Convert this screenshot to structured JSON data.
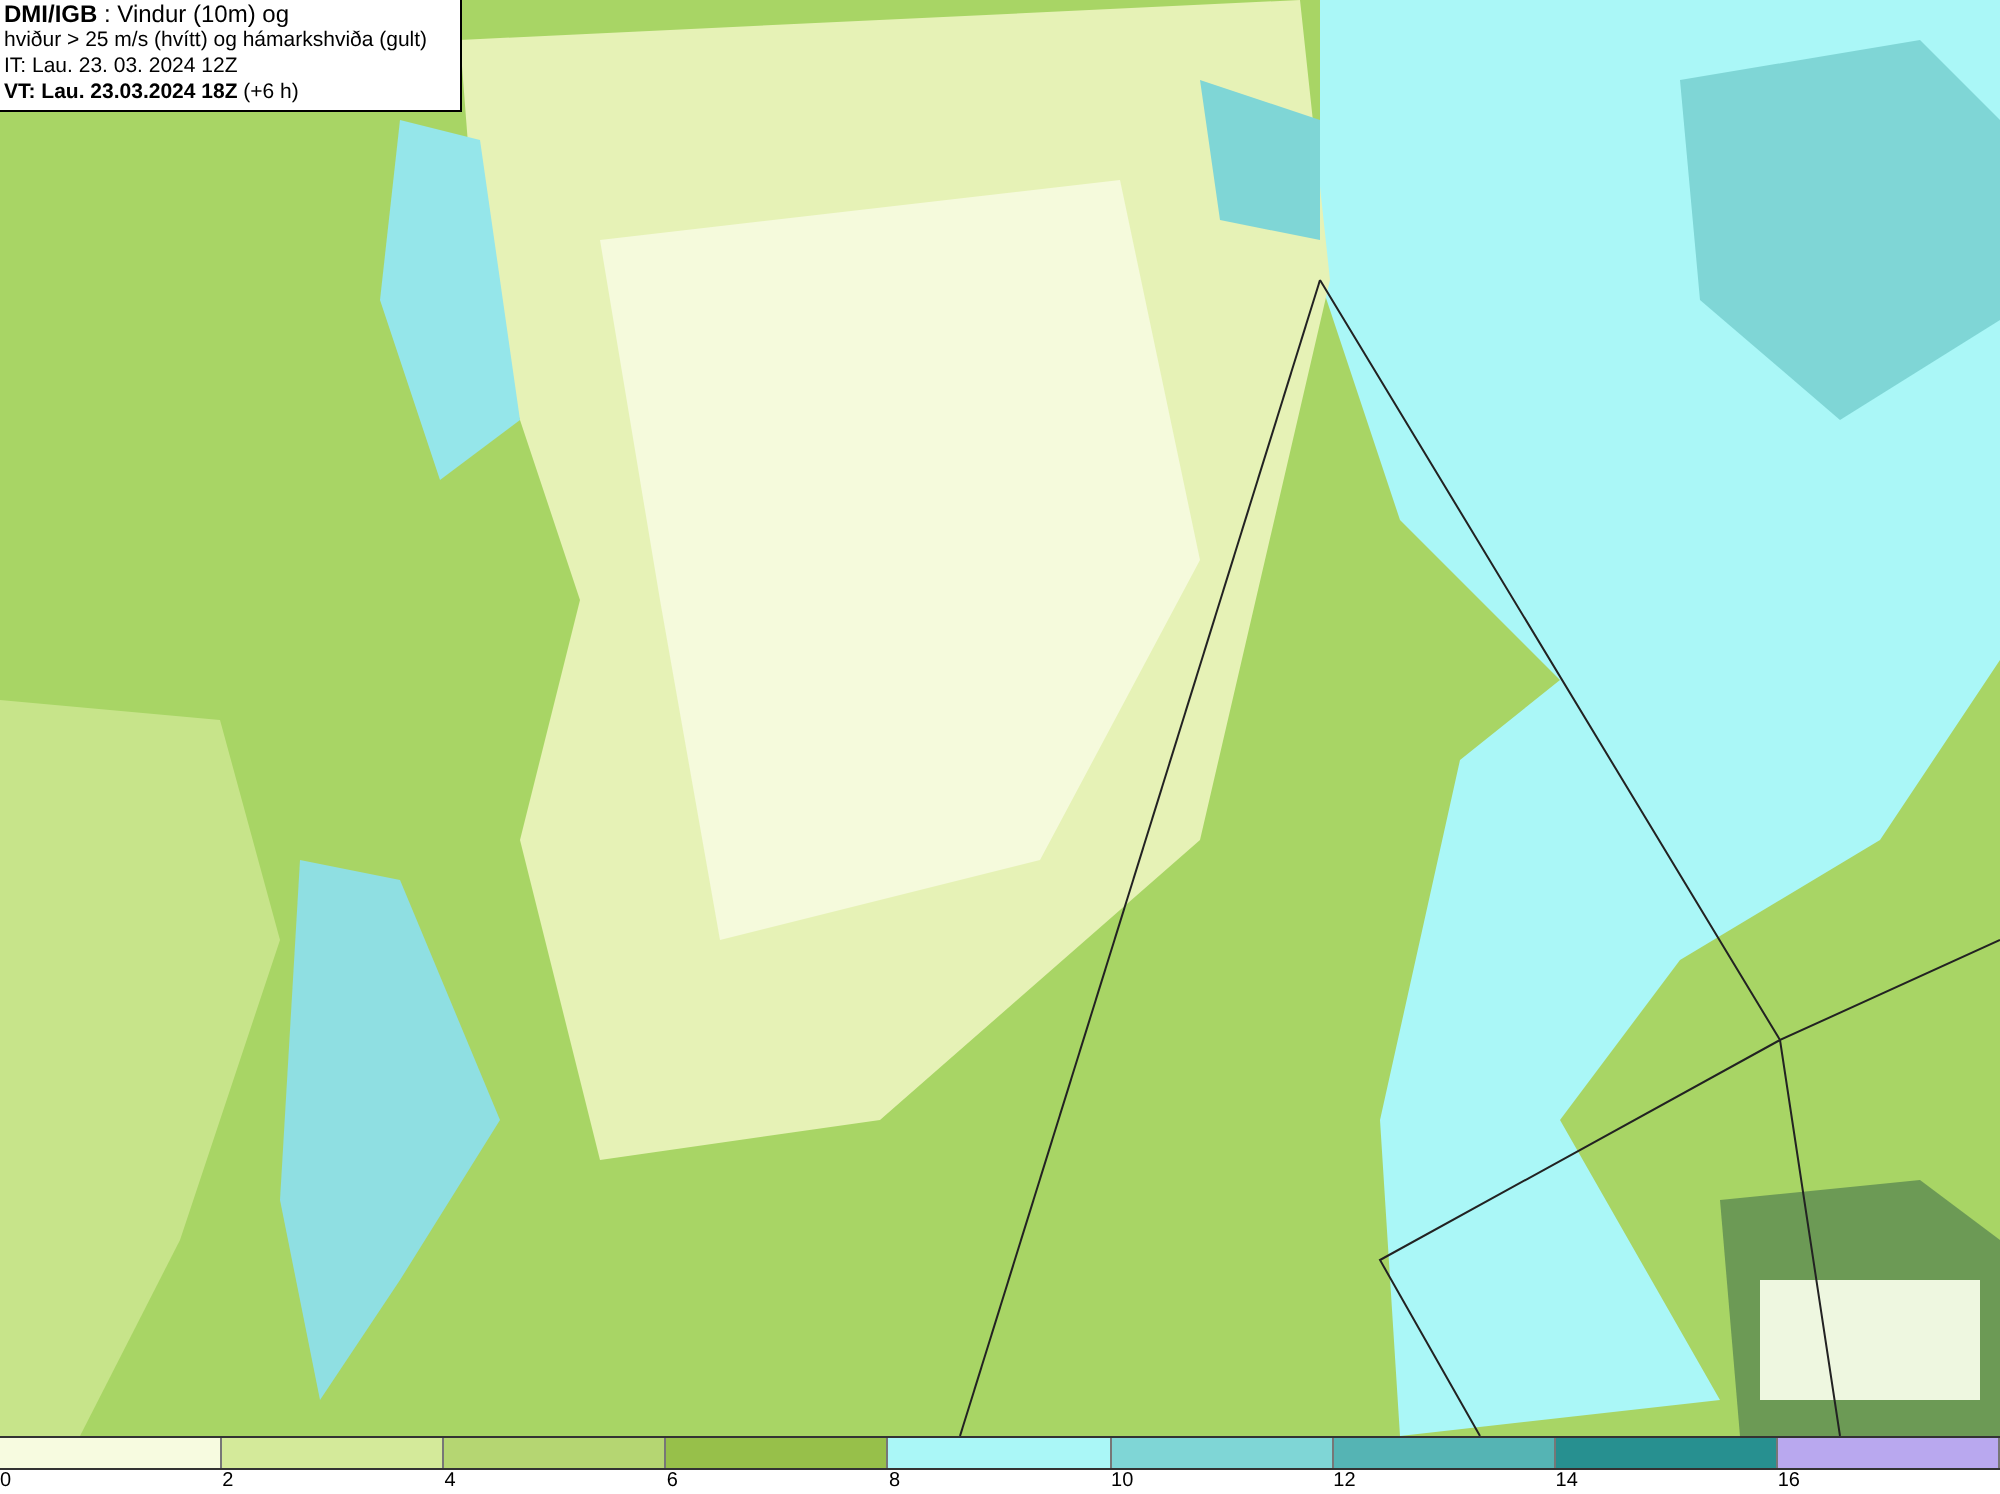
{
  "title_box": {
    "lines": [
      "**DMI/IGB** : Vindur (10m) og",
      "hviður > 25 m/s (hvítt) og hámarkshviða (gult)",
      "IT: Lau. 23. 03. 2024 12Z",
      "**VT: Lau. 23.03.2024 18Z** (+6 h)"
    ]
  },
  "legend": {
    "bins": [
      {
        "color": "#f7fbe0"
      },
      {
        "color": "#d4ea9a"
      },
      {
        "color": "#b5d672"
      },
      {
        "color": "#97c04a"
      },
      {
        "color": "#aaf7f7"
      },
      {
        "color": "#7fd6d6"
      },
      {
        "color": "#55b4b4"
      },
      {
        "color": "#279090"
      },
      {
        "color": "#b9a8ef"
      }
    ],
    "labels": [
      "0",
      "2",
      "4",
      "6",
      "8",
      "10",
      "12",
      "14",
      "16"
    ]
  }
}
